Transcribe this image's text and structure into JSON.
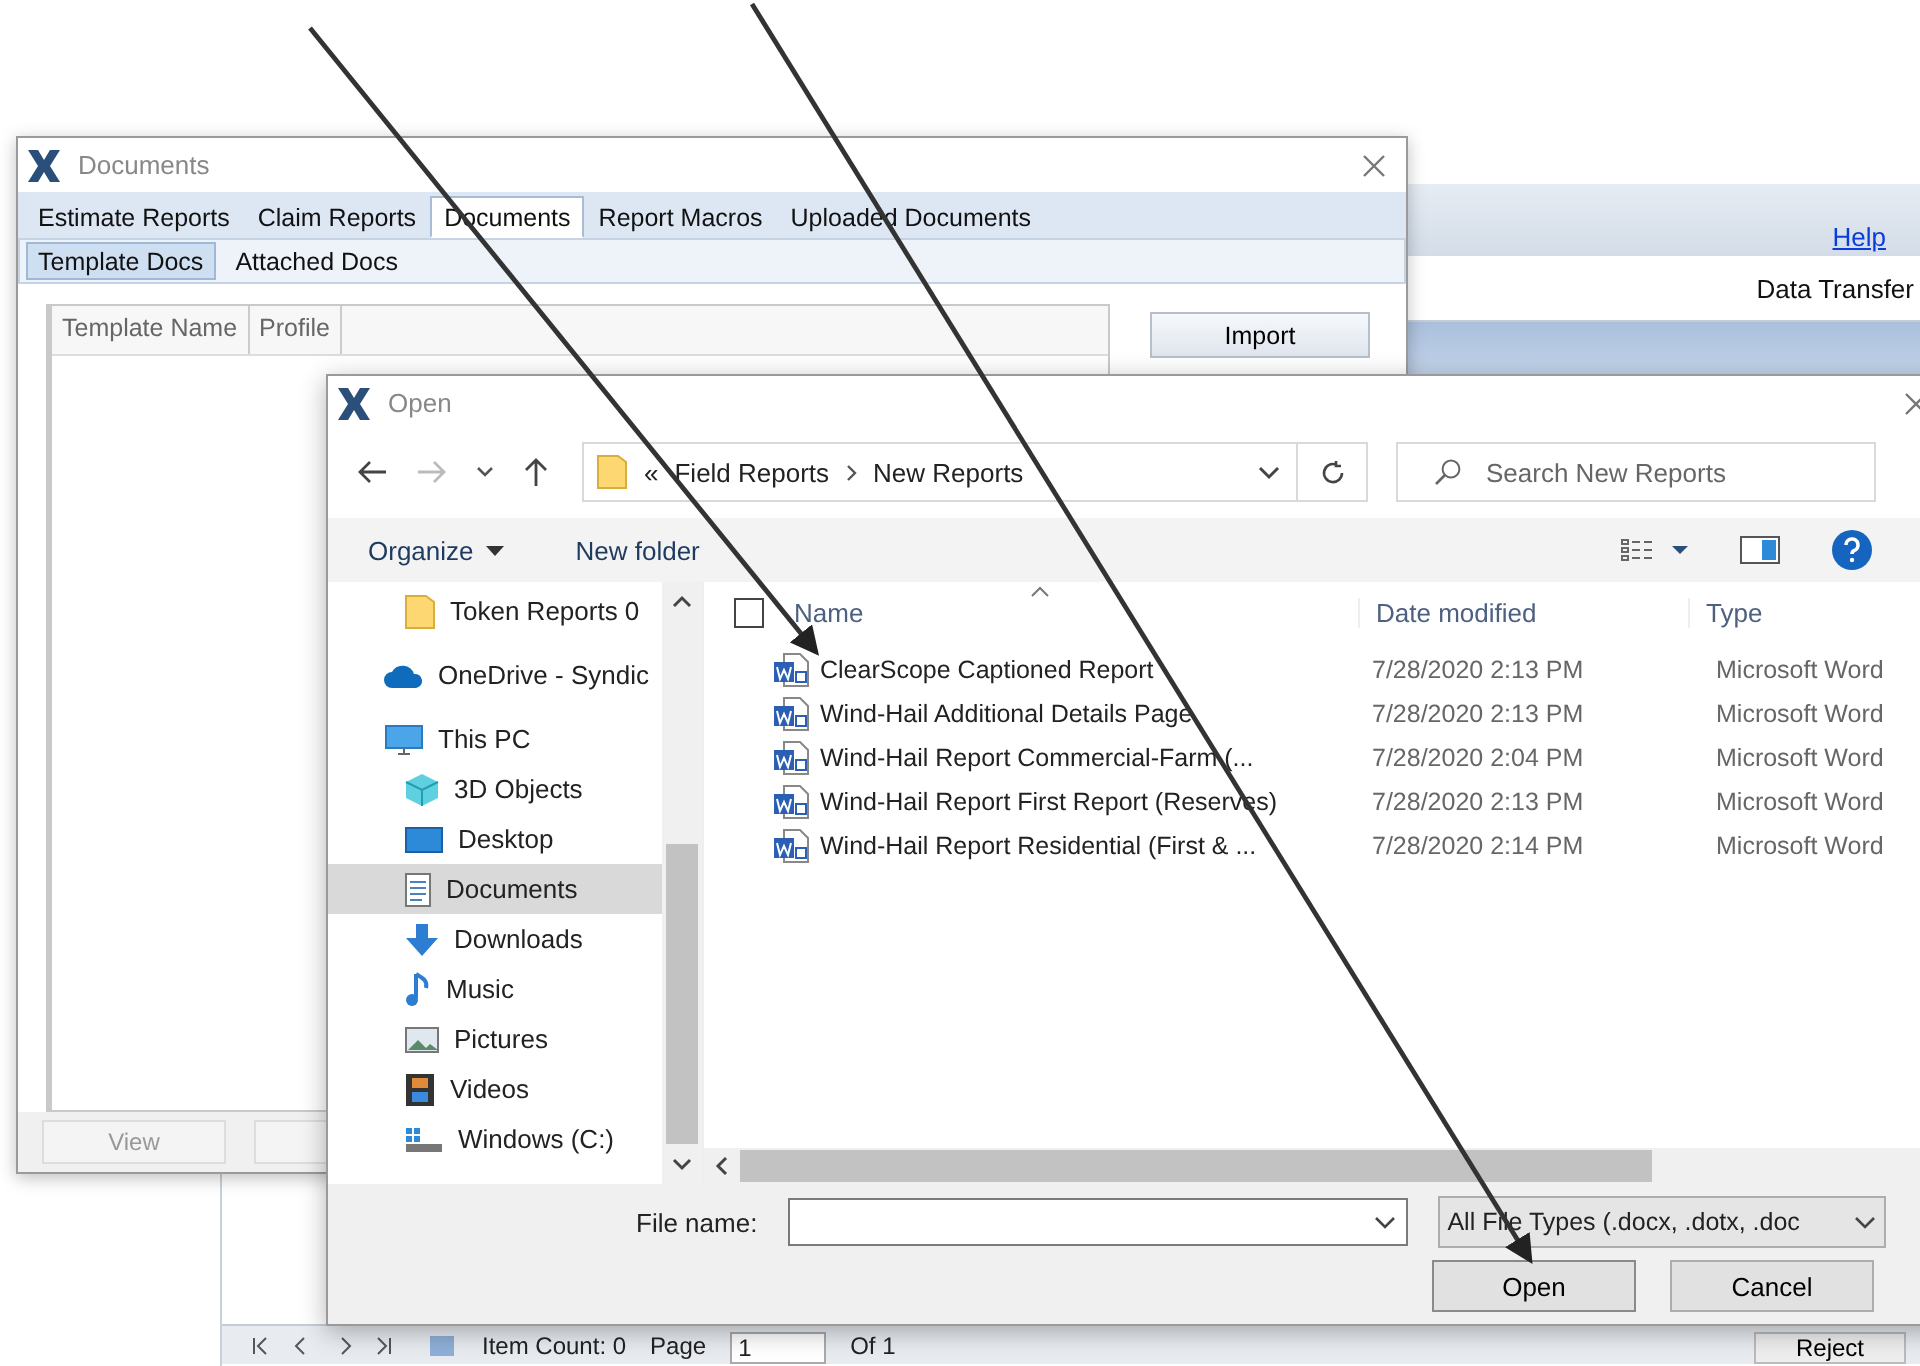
{
  "background_app": {
    "help_link": "Help",
    "toolbar_button": "Data Transfer",
    "status_bar": {
      "item_count": "Item Count: 0",
      "page_label": "Page",
      "page_value": "1",
      "page_total": "Of 1",
      "reject_button": "Reject"
    }
  },
  "documents_window": {
    "title": "Documents",
    "tabs": [
      {
        "label": "Estimate Reports",
        "selected": false
      },
      {
        "label": "Claim Reports",
        "selected": false
      },
      {
        "label": "Documents",
        "selected": true
      },
      {
        "label": "Report Macros",
        "selected": false
      },
      {
        "label": "Uploaded Documents",
        "selected": false
      }
    ],
    "subtabs": [
      {
        "label": "Template Docs",
        "selected": true
      },
      {
        "label": "Attached Docs",
        "selected": false
      }
    ],
    "table": {
      "columns": [
        "Template Name",
        "Profile"
      ]
    },
    "import_button": "Import",
    "view_button": "View"
  },
  "open_dialog": {
    "title": "Open",
    "address": {
      "overflow": "«",
      "segments": [
        "Field Reports",
        "New Reports"
      ]
    },
    "search": {
      "placeholder": "Search New Reports"
    },
    "toolbar": {
      "organize": "Organize",
      "new_folder": "New folder"
    },
    "nav_items": [
      {
        "label": "Token Reports 0",
        "kind": "folder",
        "selected": false
      },
      {
        "label": "OneDrive - Syndic",
        "kind": "cloud",
        "selected": false
      },
      {
        "label": "This PC",
        "kind": "pc",
        "selected": false,
        "children": [
          {
            "label": "3D Objects",
            "kind": "objects",
            "selected": false
          },
          {
            "label": "Desktop",
            "kind": "desktop",
            "selected": false
          },
          {
            "label": "Documents",
            "kind": "documents",
            "selected": true
          },
          {
            "label": "Downloads",
            "kind": "downloads",
            "selected": false
          },
          {
            "label": "Music",
            "kind": "music",
            "selected": false
          },
          {
            "label": "Pictures",
            "kind": "pictures",
            "selected": false
          },
          {
            "label": "Videos",
            "kind": "videos",
            "selected": false
          },
          {
            "label": "Windows (C:)",
            "kind": "drive",
            "selected": false
          }
        ]
      }
    ],
    "select_all_checked": false,
    "columns": [
      "Name",
      "Date modified",
      "Type"
    ],
    "files": [
      {
        "name": "ClearScope Captioned Report",
        "date": "7/28/2020 2:13 PM",
        "type": "Microsoft Word",
        "selected": false
      },
      {
        "name": "Wind-Hail Additional Details Page",
        "date": "7/28/2020 2:13 PM",
        "type": "Microsoft Word",
        "selected": false
      },
      {
        "name": "Wind-Hail Report Commercial-Farm (...",
        "date": "7/28/2020 2:04 PM",
        "type": "Microsoft Word",
        "selected": false
      },
      {
        "name": "Wind-Hail Report First Report (Reserves)",
        "date": "7/28/2020 2:13 PM",
        "type": "Microsoft Word",
        "selected": false
      },
      {
        "name": "Wind-Hail Report Residential (First & ...",
        "date": "7/28/2020 2:14 PM",
        "type": "Microsoft Word",
        "selected": false
      }
    ],
    "file_name_label": "File name:",
    "file_type": "All File Types (.docx, .dotx, .doc",
    "buttons": [
      {
        "label": "Open",
        "kind": "primary"
      },
      {
        "label": "Cancel",
        "kind": "secondary"
      }
    ]
  }
}
